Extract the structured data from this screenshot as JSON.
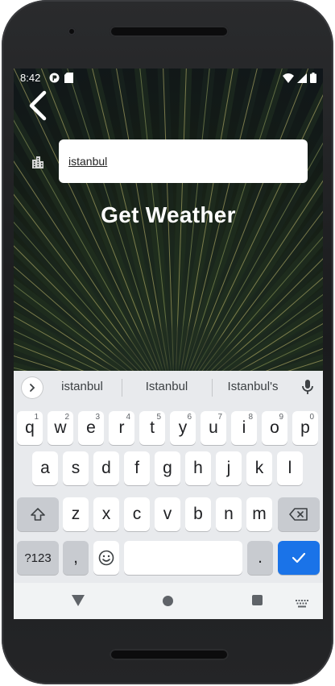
{
  "status_bar": {
    "time": "8:42",
    "left_icons": [
      "notification-icon",
      "sd-card-icon"
    ],
    "right_icons": [
      "wifi-icon",
      "signal-icon",
      "battery-icon"
    ]
  },
  "app": {
    "back_icon": "chevron-left-icon",
    "city_icon": "city-buildings-icon",
    "city_input_value": "istanbul",
    "get_weather_label": "Get Weather"
  },
  "keyboard": {
    "suggestions": [
      "istanbul",
      "Istanbul",
      "Istanbul's"
    ],
    "row1": [
      {
        "k": "q",
        "h": "1"
      },
      {
        "k": "w",
        "h": "2"
      },
      {
        "k": "e",
        "h": "3"
      },
      {
        "k": "r",
        "h": "4"
      },
      {
        "k": "t",
        "h": "5"
      },
      {
        "k": "y",
        "h": "6"
      },
      {
        "k": "u",
        "h": "7"
      },
      {
        "k": "i",
        "h": "8"
      },
      {
        "k": "o",
        "h": "9"
      },
      {
        "k": "p",
        "h": "0"
      }
    ],
    "row2": [
      "a",
      "s",
      "d",
      "f",
      "g",
      "h",
      "j",
      "k",
      "l"
    ],
    "row3": [
      "z",
      "x",
      "c",
      "v",
      "b",
      "n",
      "m"
    ],
    "symbols_label": "?123",
    "comma_label": ",",
    "period_label": ".",
    "accent_color": "#1a73e8"
  },
  "nav_bar": {
    "icons": [
      "nav-back-icon",
      "nav-home-icon",
      "nav-recents-icon",
      "keyboard-switch-icon"
    ]
  }
}
